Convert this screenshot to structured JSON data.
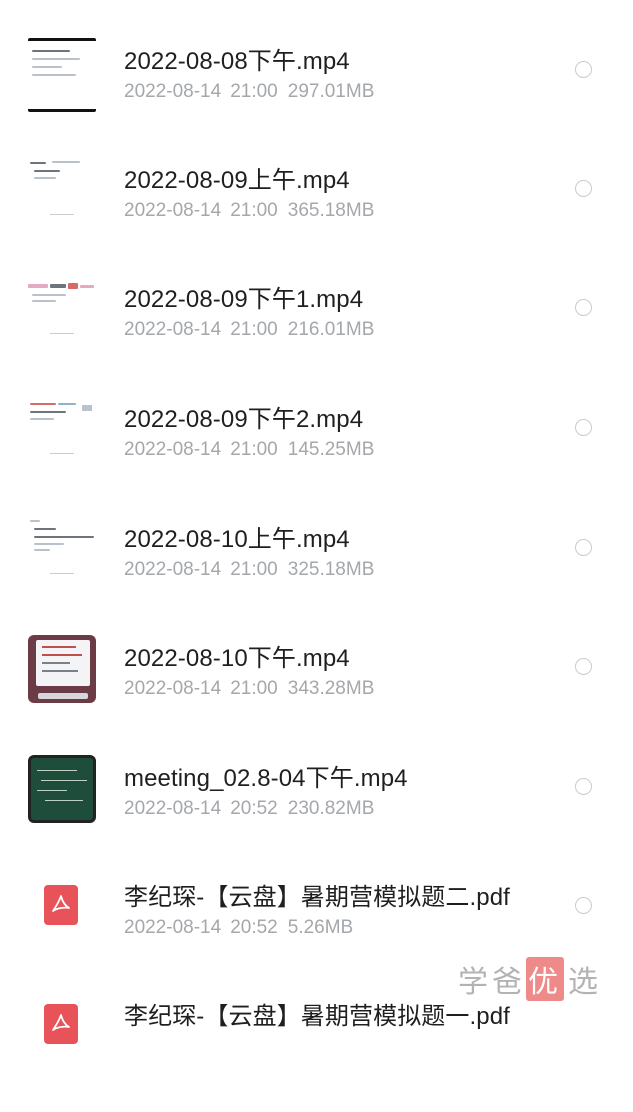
{
  "files": [
    {
      "name": "2022-08-08下午.mp4",
      "date": "2022-08-14",
      "time": "21:00",
      "size": "297.01MB",
      "thumb": "video-doc-framed"
    },
    {
      "name": "2022-08-09上午.mp4",
      "date": "2022-08-14",
      "time": "21:00",
      "size": "365.18MB",
      "thumb": "video-doc"
    },
    {
      "name": "2022-08-09下午1.mp4",
      "date": "2022-08-14",
      "time": "21:00",
      "size": "216.01MB",
      "thumb": "video-doc"
    },
    {
      "name": "2022-08-09下午2.mp4",
      "date": "2022-08-14",
      "time": "21:00",
      "size": "145.25MB",
      "thumb": "video-doc"
    },
    {
      "name": "2022-08-10上午.mp4",
      "date": "2022-08-14",
      "time": "21:00",
      "size": "325.18MB",
      "thumb": "video-doc"
    },
    {
      "name": "2022-08-10下午.mp4",
      "date": "2022-08-14",
      "time": "21:00",
      "size": "343.28MB",
      "thumb": "video-slides"
    },
    {
      "name": "meeting_02.8-04下午.mp4",
      "date": "2022-08-14",
      "time": "20:52",
      "size": "230.82MB",
      "thumb": "video-blackboard"
    },
    {
      "name": "李纪琛-【云盘】暑期营模拟题二.pdf",
      "date": "2022-08-14",
      "time": "20:52",
      "size": "5.26MB",
      "thumb": "pdf-icon"
    },
    {
      "name": "李纪琛-【云盘】暑期营模拟题一.pdf",
      "date": "",
      "time": "",
      "size": "",
      "thumb": "pdf-icon"
    }
  ],
  "watermark": {
    "part1": "学爸",
    "highlight": "优",
    "part2": "选"
  },
  "colors": {
    "name_text": "#1f1f1f",
    "meta_text": "#a4a7ab",
    "radio_border": "#c9cbce",
    "pdf_icon": "#e8535a"
  },
  "icons": {
    "row_select": "radio-circle-icon",
    "pdf": "pdf-icon"
  }
}
